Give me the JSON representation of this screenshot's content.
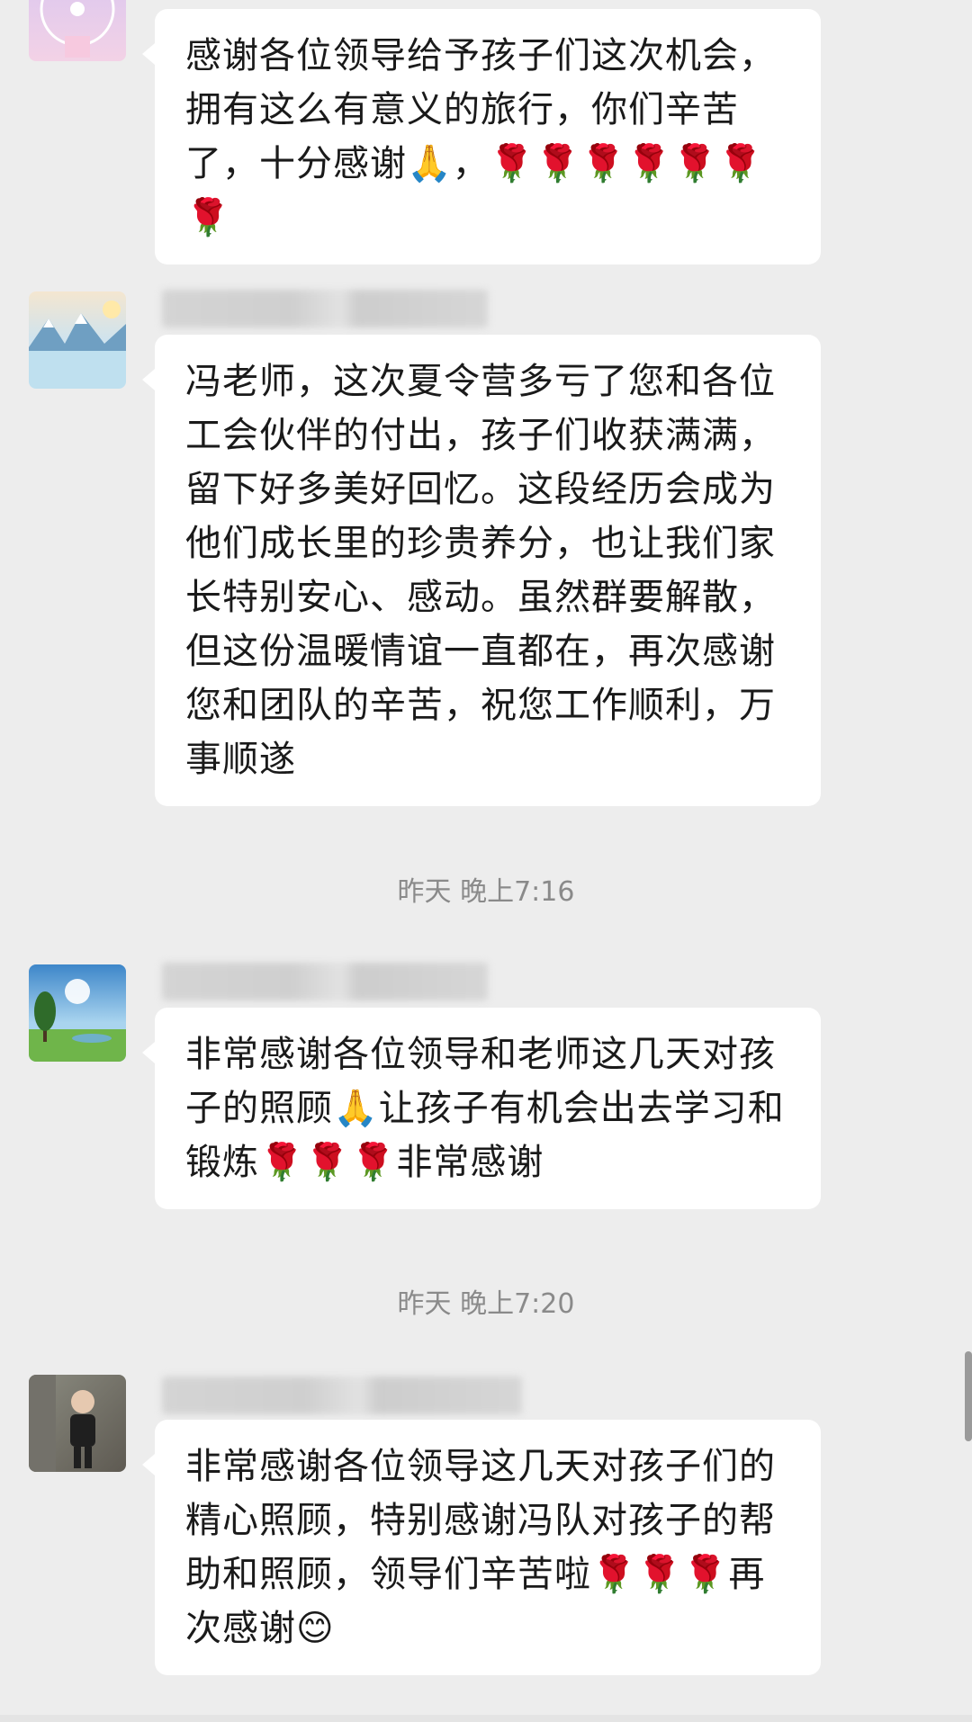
{
  "messages": [
    {
      "text": "感谢各位领导给予孩子们这次机会，拥有这么有意义的旅行，你们辛苦了，十分感谢🙏，🌹🌹🌹🌹🌹🌹🌹"
    },
    {
      "text": "冯老师，这次夏令营多亏了您和各位工会伙伴的付出，孩子们收获满满，留下好多美好回忆。这段经历会成为他们成长里的珍贵养分，也让我们家长特别安心、感动。虽然群要解散，但这份温暖情谊一直都在，再次感谢您和团队的辛苦，祝您工作顺利，万事顺遂"
    },
    {
      "text": "非常感谢各位领导和老师这几天对孩子的照顾🙏让孩子有机会出去学习和锻炼🌹🌹🌹非常感谢"
    },
    {
      "text": "非常感谢各位领导这几天对孩子们的精心照顾，特别感谢冯队对孩子的帮助和照顾，领导们辛苦啦🌹🌹🌹再次感谢😊"
    }
  ],
  "timestamps": [
    "昨天 晚上7:16",
    "昨天 晚上7:20"
  ],
  "colors": {
    "background": "#ededed",
    "bubble": "#ffffff",
    "text": "#1a1a1a",
    "timestamp": "#8a8a8a"
  }
}
